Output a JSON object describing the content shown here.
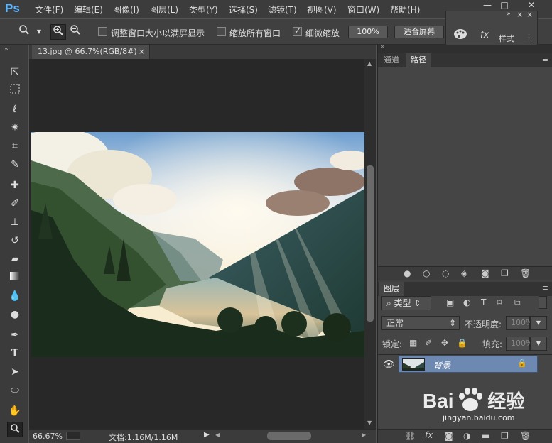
{
  "app": {
    "logo": "Ps"
  },
  "menu": [
    "文件(F)",
    "编辑(E)",
    "图像(I)",
    "图层(L)",
    "类型(Y)",
    "选择(S)",
    "滤镜(T)",
    "视图(V)",
    "窗口(W)",
    "帮助(H)"
  ],
  "window_controls": {
    "minimize": "—",
    "maximize": "□",
    "close": "✕"
  },
  "options": {
    "fit_window_label": "调整窗口大小以满屏显示",
    "fit_window_checked": false,
    "zoom_all_label": "缩放所有窗口",
    "zoom_all_checked": false,
    "scrubby_label": "细微缩放",
    "scrubby_checked": true,
    "btn_100": "100%",
    "btn_fit": "适合屏幕"
  },
  "float_panel": {
    "styles_label": "样式"
  },
  "document": {
    "tab_title": "13.jpg @ 66.7%(RGB/8#)",
    "close": "×"
  },
  "status": {
    "zoom": "66.67%",
    "doc_info": "文档:1.16M/1.16M"
  },
  "panels": {
    "channels_tab": "通道",
    "paths_tab": "路径",
    "layers_tab": "图层",
    "kind_label": "类型",
    "blend_mode": "正常",
    "opacity_label": "不透明度:",
    "opacity_value": "100%",
    "lock_label": "锁定:",
    "fill_label": "填充:",
    "fill_value": "100%",
    "layer_name": "背景"
  },
  "watermark": {
    "brand": "Bai",
    "brand2": "经验",
    "url": "jingyan.baidu.com"
  }
}
